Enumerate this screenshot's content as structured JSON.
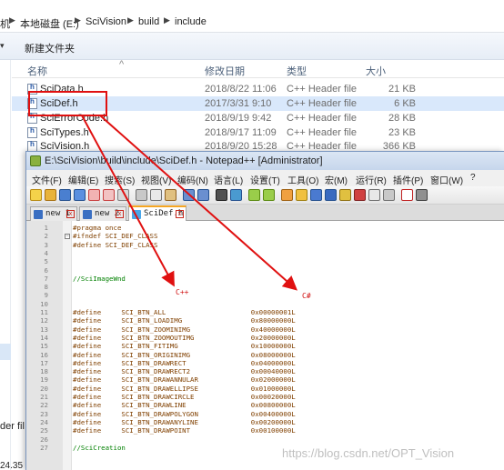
{
  "explorer": {
    "breadcrumb": [
      "机",
      "本地磁盘 (E:)",
      "SciVision",
      "build",
      "include"
    ],
    "toolbar": {
      "new_folder": "新建文件夹"
    },
    "columns": {
      "name": "名称",
      "modified": "修改日期",
      "type": "类型",
      "size": "大小"
    },
    "files": [
      {
        "name": "SciData.h",
        "modified": "2018/8/22 11:06",
        "type": "C++ Header file",
        "size": "21 KB",
        "selected": false
      },
      {
        "name": "SciDef.h",
        "modified": "2017/3/31 9:10",
        "type": "C++ Header file",
        "size": "6 KB",
        "selected": true
      },
      {
        "name": "SciErrorCode.h",
        "modified": "2018/9/19 9:42",
        "type": "C++ Header file",
        "size": "28 KB",
        "selected": false
      },
      {
        "name": "SciTypes.h",
        "modified": "2018/9/17 11:09",
        "type": "C++ Header file",
        "size": "23 KB",
        "selected": false
      },
      {
        "name": "SciVision.h",
        "modified": "2018/9/20 15:28",
        "type": "C++ Header file",
        "size": "366 KB",
        "selected": false
      }
    ],
    "left_fragments": {
      "header_fragment": "der fil",
      "status_fragment": "24.35"
    }
  },
  "notepad": {
    "title": "E:\\SciVision\\build\\include\\SciDef.h - Notepad++ [Administrator]",
    "menu": [
      "文件(F)",
      "编辑(E)",
      "搜索(S)",
      "视图(V)",
      "编码(N)",
      "语言(L)",
      "设置(T)",
      "工具(O)",
      "宏(M)",
      "运行(R)",
      "插件(P)",
      "窗口(W)",
      "?"
    ],
    "tabs": [
      {
        "label": "new 1",
        "active": false
      },
      {
        "label": "new 2",
        "active": false
      },
      {
        "label": "SciDef.h",
        "active": true
      }
    ],
    "lines": [
      {
        "n": "1",
        "text": "#pragma once",
        "kind": "pp"
      },
      {
        "n": "2",
        "text": "#ifndef SCI_DEF_CLASS",
        "kind": "pp"
      },
      {
        "n": "3",
        "text": "#define SCI_DEF_CLASS",
        "kind": "pp"
      },
      {
        "n": "4",
        "text": "",
        "kind": "pp"
      },
      {
        "n": "5",
        "text": "",
        "kind": "pp"
      },
      {
        "n": "6",
        "text": "",
        "kind": "pp"
      },
      {
        "n": "7",
        "text": "//SciImageWnd",
        "kind": "comment"
      },
      {
        "n": "8",
        "text": "",
        "kind": "pp"
      },
      {
        "n": "9",
        "text": "",
        "kind": "pp"
      },
      {
        "n": "10",
        "text": "",
        "kind": "pp"
      },
      {
        "n": "11",
        "text": "#define     SCI_BTN_ALL                     0x00000001L",
        "kind": "pp"
      },
      {
        "n": "12",
        "text": "#define     SCI_BTN_LOADIMG                 0x80000000L",
        "kind": "pp"
      },
      {
        "n": "13",
        "text": "#define     SCI_BTN_ZOOMINIMG               0x40000000L",
        "kind": "pp"
      },
      {
        "n": "14",
        "text": "#define     SCI_BTN_ZOOMOUTIMG              0x20000000L",
        "kind": "pp"
      },
      {
        "n": "15",
        "text": "#define     SCI_BTN_FITIMG                  0x10000000L",
        "kind": "pp"
      },
      {
        "n": "16",
        "text": "#define     SCI_BTN_ORIGINIMG               0x08000000L",
        "kind": "pp"
      },
      {
        "n": "17",
        "text": "#define     SCI_BTN_DRAWRECT                0x04000000L",
        "kind": "pp"
      },
      {
        "n": "18",
        "text": "#define     SCI_BTN_DRAWRECT2               0x00040000L",
        "kind": "pp"
      },
      {
        "n": "19",
        "text": "#define     SCI_BTN_DRAWANNULAR             0x02000000L",
        "kind": "pp"
      },
      {
        "n": "20",
        "text": "#define     SCI_BTN_DRAWELLIPSE             0x01000000L",
        "kind": "pp"
      },
      {
        "n": "21",
        "text": "#define     SCI_BTN_DRAWCIRCLE              0x00020000L",
        "kind": "pp"
      },
      {
        "n": "22",
        "text": "#define     SCI_BTN_DRAWLINE                0x00800000L",
        "kind": "pp"
      },
      {
        "n": "23",
        "text": "#define     SCI_BTN_DRAWPOLYGON             0x00400000L",
        "kind": "pp"
      },
      {
        "n": "24",
        "text": "#define     SCI_BTN_DRAWANYLINE             0x00200000L",
        "kind": "pp"
      },
      {
        "n": "25",
        "text": "#define     SCI_BTN_DRAWPOINT               0x00100000L",
        "kind": "pp"
      },
      {
        "n": "26",
        "text": "",
        "kind": "pp"
      },
      {
        "n": "27",
        "text": "//SciCreation",
        "kind": "comment"
      }
    ],
    "annotations": {
      "cpp": "C++",
      "csharp": "C#"
    }
  },
  "watermark": "https://blog.csdn.net/OPT_Vision",
  "colors": {
    "highlight": "#e01010",
    "selection": "#d9e8fb",
    "comment": "#008000",
    "code": "#804000"
  }
}
